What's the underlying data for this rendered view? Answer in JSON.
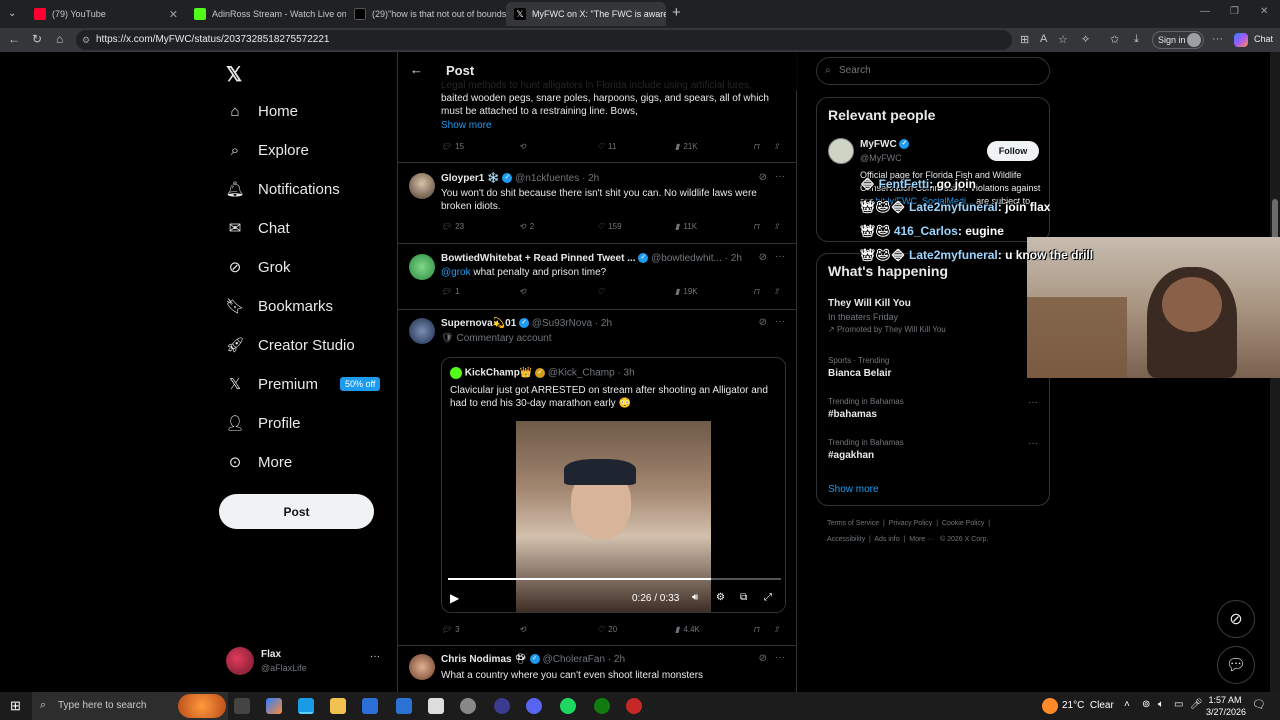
{
  "browser": {
    "tabs": [
      {
        "title": "(79) YouTube",
        "color": "#ff0033"
      },
      {
        "title": "AdinRoss Stream - Watch Live on",
        "color": "#53fc18"
      },
      {
        "title": "(29)\"how is that not out of bounds",
        "color": "#ffffff"
      },
      {
        "title": "MyFWC on X: \"The FWC is aware",
        "color": "#ffffff"
      }
    ],
    "url": "https://x.com/MyFWC/status/2037328518275572221",
    "signin_label": "Sign in",
    "chat_label": "Chat"
  },
  "sidebar": {
    "items": [
      {
        "label": "Home",
        "icon": "home-icon"
      },
      {
        "label": "Explore",
        "icon": "search-icon"
      },
      {
        "label": "Notifications",
        "icon": "bell-icon"
      },
      {
        "label": "Chat",
        "icon": "mail-icon"
      },
      {
        "label": "Grok",
        "icon": "grok-icon"
      },
      {
        "label": "Bookmarks",
        "icon": "bookmark-icon"
      },
      {
        "label": "Creator Studio",
        "icon": "rocket-icon"
      },
      {
        "label": "Premium",
        "icon": "x-icon"
      },
      {
        "label": "Profile",
        "icon": "person-icon"
      },
      {
        "label": "More",
        "icon": "more-circle-icon"
      }
    ],
    "premium_badge": "50% off",
    "post_label": "Post",
    "account": {
      "name": "Flax",
      "handle": "@aFlaxLife"
    }
  },
  "header": {
    "title": "Post"
  },
  "tweets": [
    {
      "partial_text": "Legal methods to hunt alligators in Florida include using artificial lures, baited wooden pegs, snare poles, harpoons, gigs, and spears, all of which must be attached to a restraining line. Bows,",
      "show_more": "Show more",
      "replies": "15",
      "reposts": "",
      "likes": "11",
      "views": "21K"
    },
    {
      "name": "Gloyper1 ❄️",
      "handle": "@n1ckfuentes",
      "time": "· 2h",
      "text": "You won't do shit because there isn't shit you can. No wildlife laws were broken idiots.",
      "replies": "23",
      "reposts": "2",
      "likes": "159",
      "views": "11K"
    },
    {
      "name": "BowtiedWhitebat + Read Pinned Tweet ...",
      "handle": "@bowtiedwhit...",
      "time": "· 2h",
      "mention": "@grok",
      "text": " what penalty and prison time?",
      "replies": "1",
      "reposts": "",
      "likes": "",
      "views": "19K"
    },
    {
      "name": "Supernova💫01",
      "handle": "@Su93rNova",
      "time": "· 2h",
      "label": "Commentary account",
      "quote": {
        "name": "KickChamp👑",
        "handle": "@Kick_Champ",
        "time": "· 3h",
        "text": "Clavicular just got ARRESTED on stream after shooting an Alligator and had to end his 30-day marathon early 😳",
        "video_time": "0:26 / 0:33",
        "progress": 0.79
      },
      "replies": "3",
      "reposts": "",
      "likes": "20",
      "views": "4.4K"
    },
    {
      "name": "Chris Nodimas",
      "handle": "@CholeraFan",
      "time": "· 2h",
      "text": "What a country where you can't even shoot literal monsters"
    }
  ],
  "right": {
    "search_placeholder": "Search",
    "relevant_title": "Relevant people",
    "person": {
      "name": "MyFWC",
      "handle": "@MyFWC",
      "follow": "Follow",
      "bio": "Official page for Florida Fish and Wildlife Conservation Commission. Violations against our",
      "bio_link": "bit.ly/FWC_SocialMedi...",
      "bio_tail": " are subject to"
    },
    "happening_title": "What's happening",
    "trends": [
      {
        "cat": "",
        "name": "They Will Kill You",
        "sub": "In theaters Friday",
        "promo": "Promoted by They Will Kill You"
      },
      {
        "cat": "Sports · Trending",
        "name": "Bianca Belair"
      },
      {
        "cat": "Trending in Bahamas",
        "name": "#bahamas"
      },
      {
        "cat": "Trending in Bahamas",
        "name": "#agakhan"
      }
    ],
    "show_more": "Show more",
    "footer": [
      "Terms of Service",
      "Privacy Policy",
      "Cookie Policy",
      "Accessibility",
      "Ads info",
      "More ···",
      "© 2026 X Corp."
    ]
  },
  "chat_overlay": [
    {
      "name": "FentFetti",
      "msg": ": go join"
    },
    {
      "name": "Late2myfuneral",
      "msg": ": join flax"
    },
    {
      "name": "416_Carlos",
      "msg": ": eugine"
    },
    {
      "name": "Late2myfuneral",
      "msg": ": u know the drill"
    }
  ],
  "taskbar": {
    "search_placeholder": "Type here to search",
    "weather": "21°C  Clear",
    "time": "1:57 AM",
    "date": "3/27/2026"
  }
}
